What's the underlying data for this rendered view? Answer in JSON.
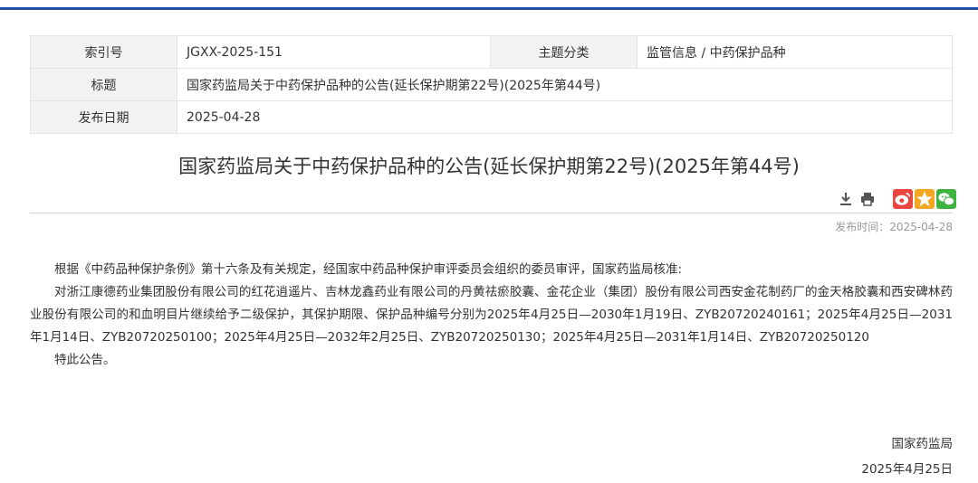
{
  "meta": {
    "index_label": "索引号",
    "index_value": "JGXX-2025-151",
    "category_label": "主题分类",
    "category_value": "监管信息 / 中药保护品种",
    "title_label": "标题",
    "title_value": "国家药监局关于中药保护品种的公告(延长保护期第22号)(2025年第44号)",
    "date_label": "发布日期",
    "date_value": "2025-04-28"
  },
  "document": {
    "title": "国家药监局关于中药保护品种的公告(延长保护期第22号)(2025年第44号)",
    "publish_time_label": "发布时间：",
    "publish_time_value": "2025-04-28",
    "paragraphs": [
      "根据《中药品种保护条例》第十六条及有关规定，经国家中药品种保护审评委员会组织的委员审评，国家药监局核准:",
      "对浙江康德药业集团股份有限公司的红花逍遥片、吉林龙鑫药业有限公司的丹黄祛瘀胶囊、金花企业（集团）股份有限公司西安金花制药厂的金天格胶囊和西安碑林药业股份有限公司的和血明目片继续给予二级保护，其保护期限、保护品种编号分别为2025年4月25日—2030年1月19日、ZYB20720240161；2025年4月25日—2031年1月14日、ZYB20720250100；2025年4月25日—2032年2月25日、ZYB20720250130；2025年4月25日—2031年1月14日、ZYB20720250120",
      "特此公告。"
    ],
    "signature_org": "国家药监局",
    "signature_date": "2025年4月25日"
  },
  "tools": {
    "icons": [
      "download-icon",
      "print-icon",
      "weibo-icon",
      "qzone-icon",
      "wechat-icon"
    ]
  },
  "colors": {
    "accent": "#1e4fa6",
    "weibo": "#e8463f",
    "qzone": "#f5a623",
    "wechat": "#3fb33f"
  }
}
